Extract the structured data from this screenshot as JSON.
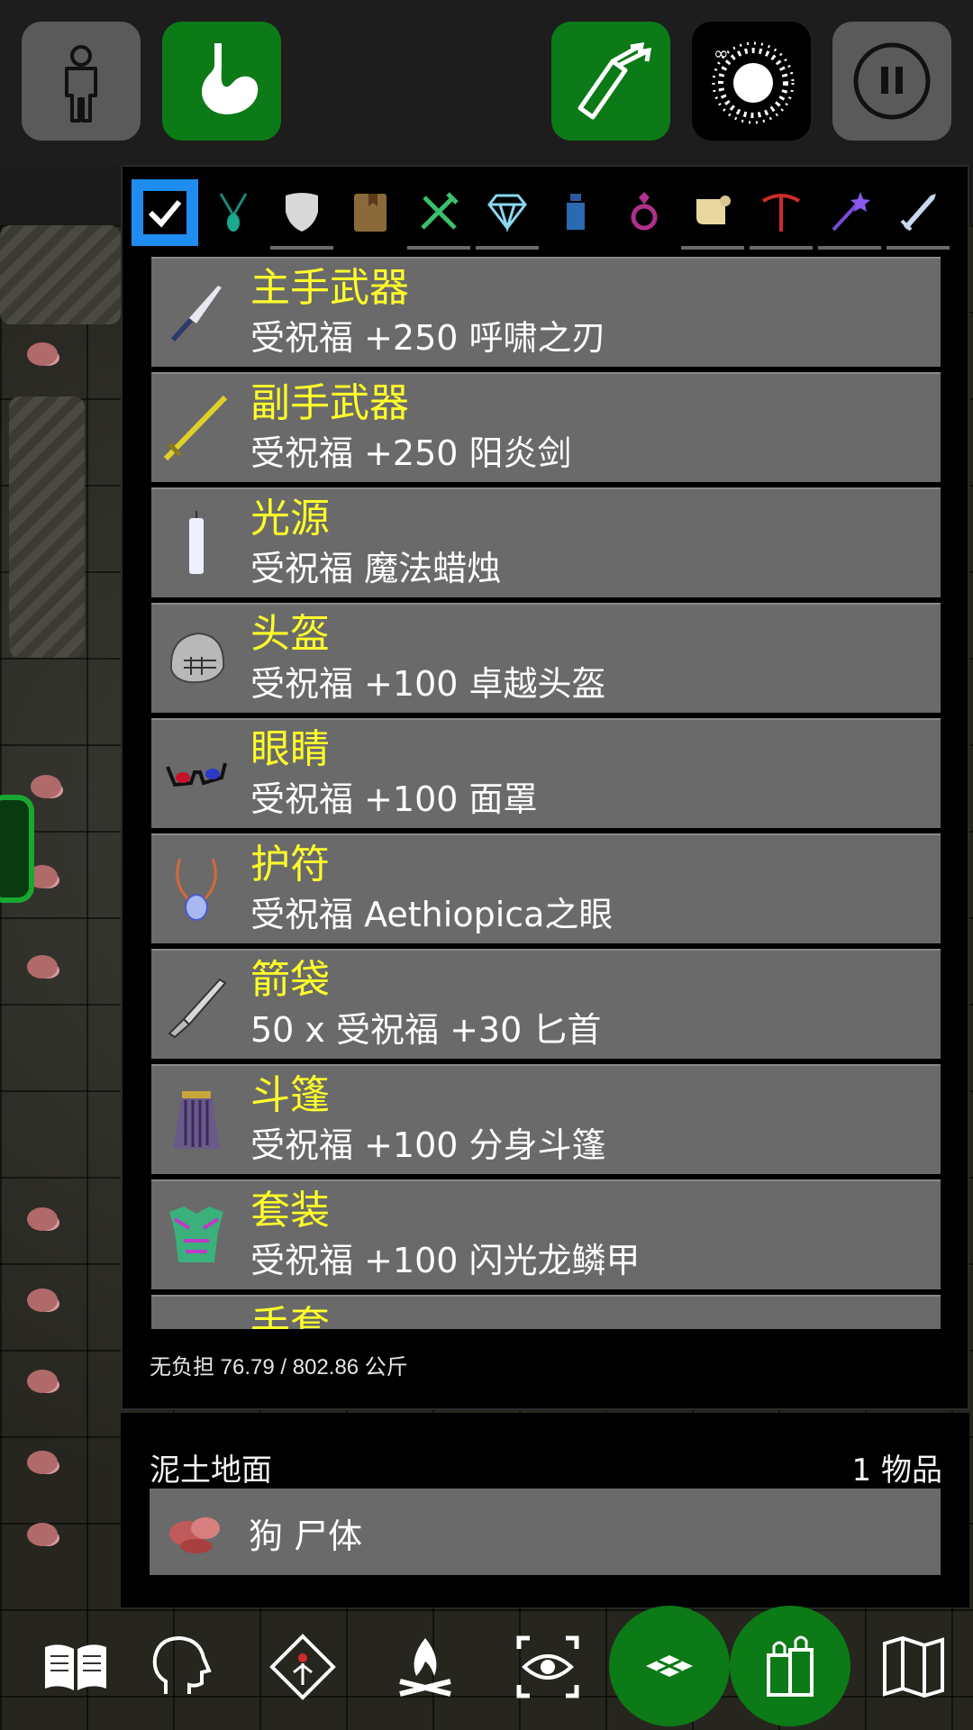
{
  "colors": {
    "accent_green": "#0c7a16",
    "slot_text_yellow": "#ffff2a",
    "selected_tab_blue": "#1f8cf0",
    "item_bg": "#6a6a6a"
  },
  "top_bar": {
    "buttons": [
      {
        "name": "character-button",
        "icon": "person-icon"
      },
      {
        "name": "hunger-button",
        "icon": "stomach-icon",
        "active": true
      },
      {
        "name": "quiver-button",
        "icon": "quiver-icon",
        "active": true
      },
      {
        "name": "effect-button",
        "icon": "infinity-starburst-icon"
      },
      {
        "name": "pause-button",
        "icon": "pause-icon"
      }
    ]
  },
  "inventory": {
    "filter_tabs": [
      "all-checkbox-icon",
      "amulet-icon",
      "shield-icon",
      "book-icon",
      "food-icon",
      "gem-icon",
      "potion-icon",
      "ring-icon",
      "scroll-icon",
      "pickaxe-icon",
      "wand-icon",
      "sword-icon"
    ],
    "items": [
      {
        "slot": "主手武器",
        "name": "受祝福 +250 呼啸之刃",
        "icon": "dagger-icon"
      },
      {
        "slot": "副手武器",
        "name": "受祝福 +250 阳炎剑",
        "icon": "golden-sword-icon"
      },
      {
        "slot": "光源",
        "name": "受祝福 魔法蜡烛",
        "icon": "candle-icon"
      },
      {
        "slot": "头盔",
        "name": "受祝福 +100 卓越头盔",
        "icon": "helmet-icon"
      },
      {
        "slot": "眼睛",
        "name": "受祝福 +100 面罩",
        "icon": "glasses-icon"
      },
      {
        "slot": "护符",
        "name": "受祝福 Aethiopica之眼",
        "icon": "amulet-icon"
      },
      {
        "slot": "箭袋",
        "name": "50 x 受祝福 +30 匕首",
        "icon": "throwing-dagger-icon"
      },
      {
        "slot": "斗篷",
        "name": "受祝福 +100 分身斗篷",
        "icon": "cloak-icon"
      },
      {
        "slot": "套装",
        "name": "受祝福 +100 闪光龙鳞甲",
        "icon": "dragon-armor-icon"
      },
      {
        "slot": "手套",
        "name": "",
        "icon": "gloves-icon"
      }
    ],
    "weight_text": "无负担 76.79 / 802.86 公斤"
  },
  "floor": {
    "title": "泥土地面",
    "count": "1 物品",
    "items": [
      {
        "name": "狗 尸体",
        "icon": "corpse-icon"
      }
    ]
  },
  "bottom_bar": {
    "buttons": [
      {
        "name": "journal-button",
        "icon": "book-open-icon"
      },
      {
        "name": "skills-button",
        "icon": "head-icon"
      },
      {
        "name": "spells-button",
        "icon": "rune-icon"
      },
      {
        "name": "rest-button",
        "icon": "campfire-icon"
      },
      {
        "name": "look-button",
        "icon": "eye-icon"
      },
      {
        "name": "floor-button",
        "icon": "tiles-icon",
        "active": true
      },
      {
        "name": "inventory-button",
        "icon": "bags-icon",
        "active": true
      },
      {
        "name": "map-button",
        "icon": "map-icon"
      }
    ]
  }
}
